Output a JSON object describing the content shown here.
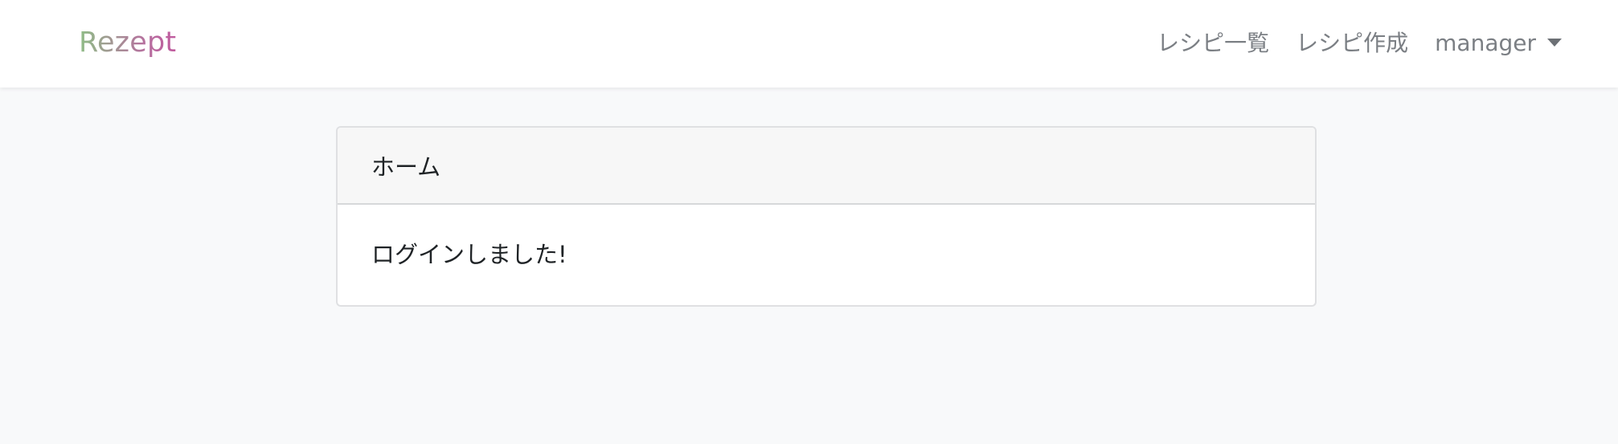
{
  "navbar": {
    "brand": "Rezept",
    "links": [
      {
        "label": "レシピ一覧"
      },
      {
        "label": "レシピ作成"
      }
    ],
    "user_menu": {
      "label": "manager"
    }
  },
  "card": {
    "header": "ホーム",
    "body_text": "ログインしました!"
  }
}
